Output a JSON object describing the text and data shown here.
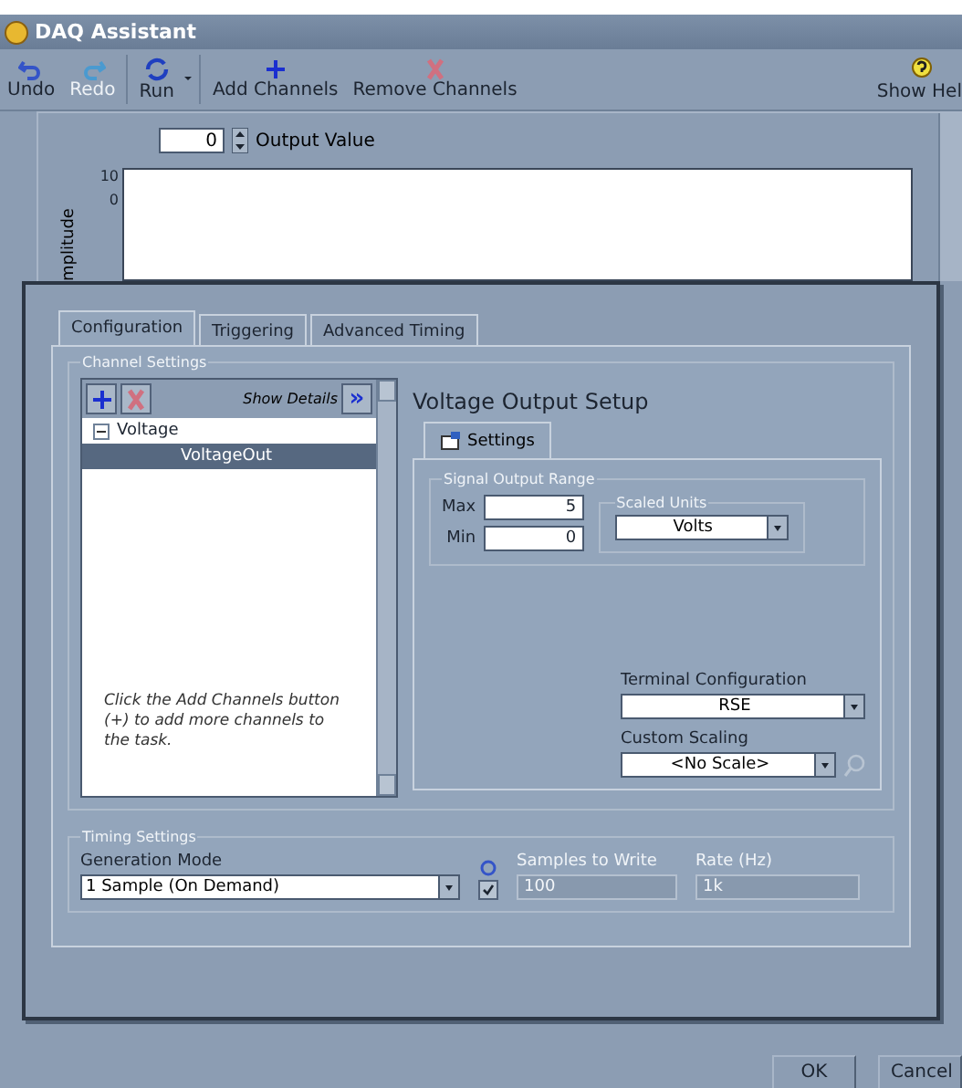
{
  "window": {
    "title": "DAQ Assistant"
  },
  "toolbar": [
    {
      "kind": "undo",
      "label": "Undo",
      "disabled": false
    },
    {
      "kind": "redo",
      "label": "Redo",
      "disabled": true
    },
    {
      "kind": "run",
      "label": "Run",
      "disabled": false
    },
    {
      "kind": "add",
      "label": "Add Channels",
      "disabled": false
    },
    {
      "kind": "remove",
      "label": "Remove Channels",
      "disabled": false
    },
    {
      "kind": "help",
      "label": "Show Hel",
      "disabled": false
    }
  ],
  "preview": {
    "output_value": "0",
    "output_label": "Output Value",
    "ylabel": "mplitude",
    "yticks": [
      "10",
      "0"
    ]
  },
  "tabs": [
    {
      "label": "Configuration",
      "selected": true
    },
    {
      "label": "Triggering",
      "selected": false
    },
    {
      "label": "Advanced Timing",
      "selected": false
    }
  ],
  "channel_settings": {
    "legend": "Channel Settings",
    "show_details": "Show Details",
    "details_icon": "»",
    "tree": [
      {
        "label": "Voltage",
        "expanded": true,
        "selected": false,
        "children": [
          {
            "label": "VoltageOut",
            "selected": true
          }
        ]
      }
    ],
    "hint": "Click the Add Channels button (+) to add more channels to the task."
  },
  "setup": {
    "title": "Voltage Output Setup",
    "tab": "Settings",
    "range_legend": "Signal Output Range",
    "max_label": "Max",
    "max": "5",
    "min_label": "Min",
    "min": "0",
    "units_legend": "Scaled Units",
    "units": "Volts",
    "terminal_label": "Terminal Configuration",
    "terminal": "RSE",
    "scaling_label": "Custom Scaling",
    "scaling": "<No Scale>"
  },
  "timing": {
    "legend": "Timing Settings",
    "mode_label": "Generation Mode",
    "mode": "1 Sample (On Demand)",
    "checked": true,
    "samples_label": "Samples to Write",
    "samples": "100",
    "samples_disabled": true,
    "rate_label": "Rate (Hz)",
    "rate": "1k",
    "rate_disabled": true
  },
  "buttons": [
    "OK",
    "Cancel"
  ]
}
